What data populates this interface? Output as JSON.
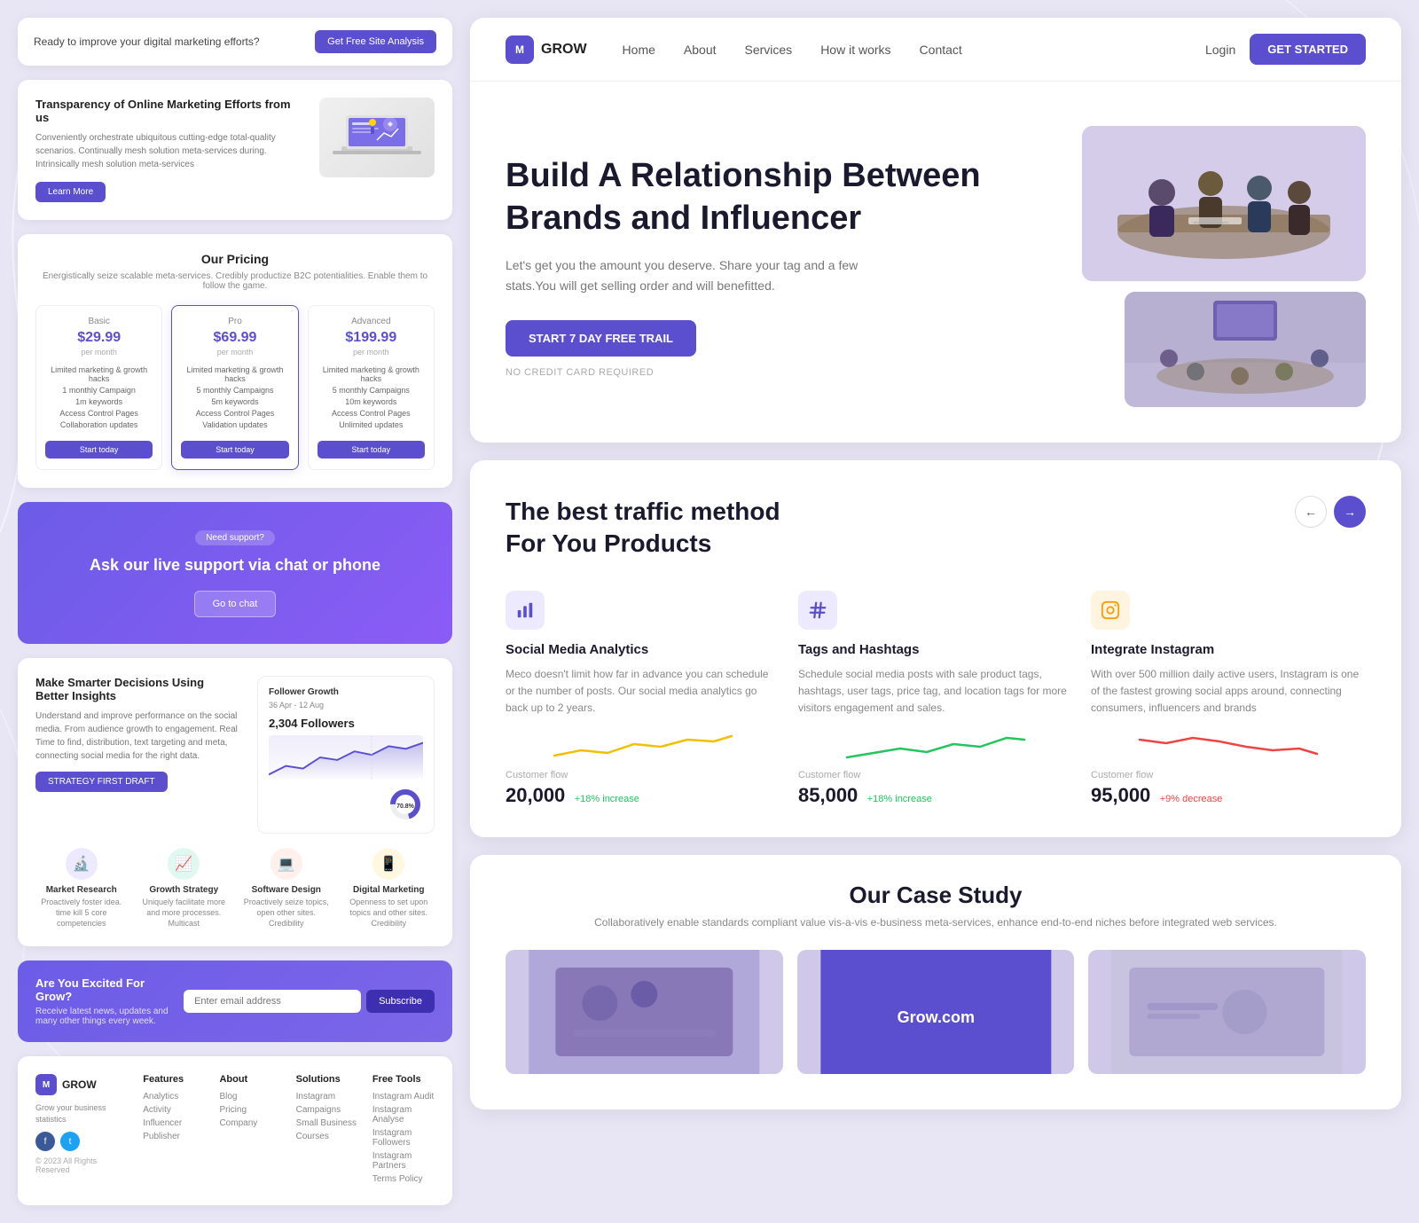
{
  "brand": {
    "logo_letter": "M",
    "name": "GROW"
  },
  "navbar": {
    "links": [
      "Home",
      "About",
      "Services",
      "How it works",
      "Contact"
    ],
    "login_label": "Login",
    "cta_label": "GET STARTED"
  },
  "left_panel": {
    "cta_banner": {
      "text": "Ready to improve your digital marketing efforts?",
      "button_label": "Get Free Site Analysis"
    },
    "hero_card": {
      "title": "Transparency of Online Marketing Efforts from us",
      "description": "Conveniently orchestrate ubiquitous cutting-edge total-quality scenarios. Continually mesh solution meta-services during. Intrinsically mesh solution meta-services",
      "button_label": "Learn More"
    },
    "pricing": {
      "title": "Our Pricing",
      "description": "Energistically seize scalable meta-services. Credibly productize B2C potentialities. Enable them to follow the game.",
      "plans": [
        {
          "name": "Basic",
          "price": "$29.99",
          "period": "per month",
          "features": [
            "Limited marketing & growth hacks",
            "1 monthly Campaign",
            "1m keywords",
            "Access Control Pages",
            "Collaboration updates"
          ],
          "button_label": "Start today"
        },
        {
          "name": "Pro",
          "price": "$69.99",
          "period": "per month",
          "featured": true,
          "features": [
            "Limited marketing & growth hacks",
            "5 monthly Campaigns",
            "5m keywords",
            "Access Control Pages",
            "Validation updates"
          ],
          "button_label": "Start today"
        },
        {
          "name": "Advanced",
          "price": "$199.99",
          "period": "per month",
          "features": [
            "Limited marketing & growth hacks",
            "5 monthly Campaigns",
            "10m keywords",
            "Access Control Pages",
            "Unlimited updates"
          ],
          "button_label": "Start today"
        }
      ]
    },
    "support": {
      "badge": "Need support?",
      "title": "Ask our live support via chat or phone",
      "button_label": "Go to chat"
    },
    "insights": {
      "title": "Make Smarter Decisions Using Better Insights",
      "description": "Understand and improve performance on the social media. From audience growth to engagement. Real Time to find, distribution, text targeting and meta, connecting social media for the right data.",
      "button_label": "STRATEGY FIRST DRAFT",
      "chart": {
        "title": "Follower Growth",
        "subtitle": "36 Apr - 12 Aug",
        "count": "2,304 Followers",
        "percentage": "70.8%"
      },
      "services": [
        {
          "name": "Market Research",
          "icon": "🔬",
          "color": "#6c5ce7",
          "description": "Proactively foster idea. time kill 5 core competencies"
        },
        {
          "name": "Growth Strategy",
          "icon": "📈",
          "color": "#00b894",
          "description": "Uniquely facilitate more and more processes. Multicast"
        },
        {
          "name": "Software Design",
          "icon": "💻",
          "color": "#e17055",
          "description": "Proactively seize topics, open other sites. Credibility"
        },
        {
          "name": "Digital Marketing",
          "icon": "📱",
          "color": "#fdcb6e",
          "description": "Openness to set upon topics and other sites. Credibility"
        }
      ]
    },
    "newsletter": {
      "title": "Are You Excited For Grow?",
      "description": "Receive latest news, updates and many other things every week.",
      "placeholder": "Enter email address",
      "button_label": "Subscribe"
    },
    "footer": {
      "brand_desc": "Grow your business statistics",
      "rights": "© 2023 All Rights Reserved",
      "columns": [
        {
          "title": "Features",
          "links": [
            "Analytics",
            "Activity",
            "Influencer",
            "Publisher"
          ]
        },
        {
          "title": "About",
          "links": [
            "Blog",
            "Pricing",
            "Company"
          ]
        },
        {
          "title": "Solutions",
          "links": [
            "Instagram",
            "Campaigns",
            "Small Business",
            "Courses"
          ]
        },
        {
          "title": "Free Tools",
          "links": [
            "Instagram Audit",
            "Instagram Analyse",
            "Instagram Followers",
            "Instagram Partners",
            "Terms Policy"
          ]
        }
      ]
    }
  },
  "right_panel": {
    "hero": {
      "title": "Build A Relationship Between Brands and Influencer",
      "description": "Let's get you the amount you deserve. Share your tag and a few stats.You will get selling order and will benefitted.",
      "cta_label": "START 7 DAY FREE TRAIL",
      "no_cc_label": "NO CREDIT CARD REQUIRED"
    },
    "traffic": {
      "title": "The best traffic method\nFor You Products",
      "cards": [
        {
          "icon": "📊",
          "icon_bg": "#ede9ff",
          "title": "Social Media Analytics",
          "description": "Meco doesn't limit how far in advance you can schedule or the number of posts. Our social media analytics go back up to 2 years.",
          "customer_flow_label": "Customer flow",
          "value": "20,000",
          "trend": "+18% increase",
          "trend_positive": true
        },
        {
          "icon": "#",
          "icon_bg": "#ede9ff",
          "title": "Tags and Hashtags",
          "description": "Schedule social media posts with sale product tags, hashtags, user tags, price tag, and location tags for more visitors engagement and sales.",
          "customer_flow_label": "Customer flow",
          "value": "85,000",
          "trend": "+18% increase",
          "trend_positive": true
        },
        {
          "icon": "📷",
          "icon_bg": "#fff4e0",
          "title": "Integrate Instagram",
          "description": "With over 500 million daily active users, Instagram is one of the fastest growing social apps around, connecting consumers, influencers and brands",
          "customer_flow_label": "Customer flow",
          "value": "95,000",
          "trend": "+9% decrease",
          "trend_positive": false
        }
      ]
    },
    "case_study": {
      "title": "Our Case Study",
      "description": "Collaboratively enable standards compliant value vis-a-vis e-business meta-services, enhance end-to-end niches before integrated web services.",
      "items": [
        {
          "label": "",
          "bg": "#b0a8d8"
        },
        {
          "label": "Grow.com",
          "bg": "#5b4fcf"
        },
        {
          "label": "",
          "bg": "#c8c4e0"
        }
      ]
    },
    "nav_arrows": {
      "prev_label": "←",
      "next_label": "→"
    }
  }
}
